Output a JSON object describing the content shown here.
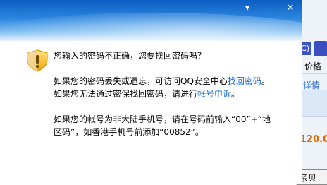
{
  "window": {
    "controls": {
      "menu": "▾",
      "minimize": "–",
      "close": "✕"
    }
  },
  "message": {
    "question": "您输入的密码不正确，您要找回密码吗？",
    "para1_line1_prefix": "如果您的密码丢失或遗忘，可访问QQ安全中心",
    "para1_line1_link": "找回密码",
    "para1_line1_suffix": "。",
    "para1_line2_prefix": "如果您无法通过密保找回密码，请进行",
    "para1_line2_link": "帐号申诉",
    "para1_line2_suffix": "。",
    "para2_line1": "如果您的帐号为非大陆手机号，请在号码前输入“00”+“地",
    "para2_line2": "区码”，如香港手机号前添加“00852”。"
  },
  "background_app": {
    "tab_letter": "(C)",
    "column_header": "价格",
    "detail_link": "详情",
    "price": "120.0",
    "button_text": "亲贝"
  },
  "colors": {
    "titlebar_top": "#0b5cc0",
    "link": "#1a6ad0",
    "price": "#d86a00"
  }
}
